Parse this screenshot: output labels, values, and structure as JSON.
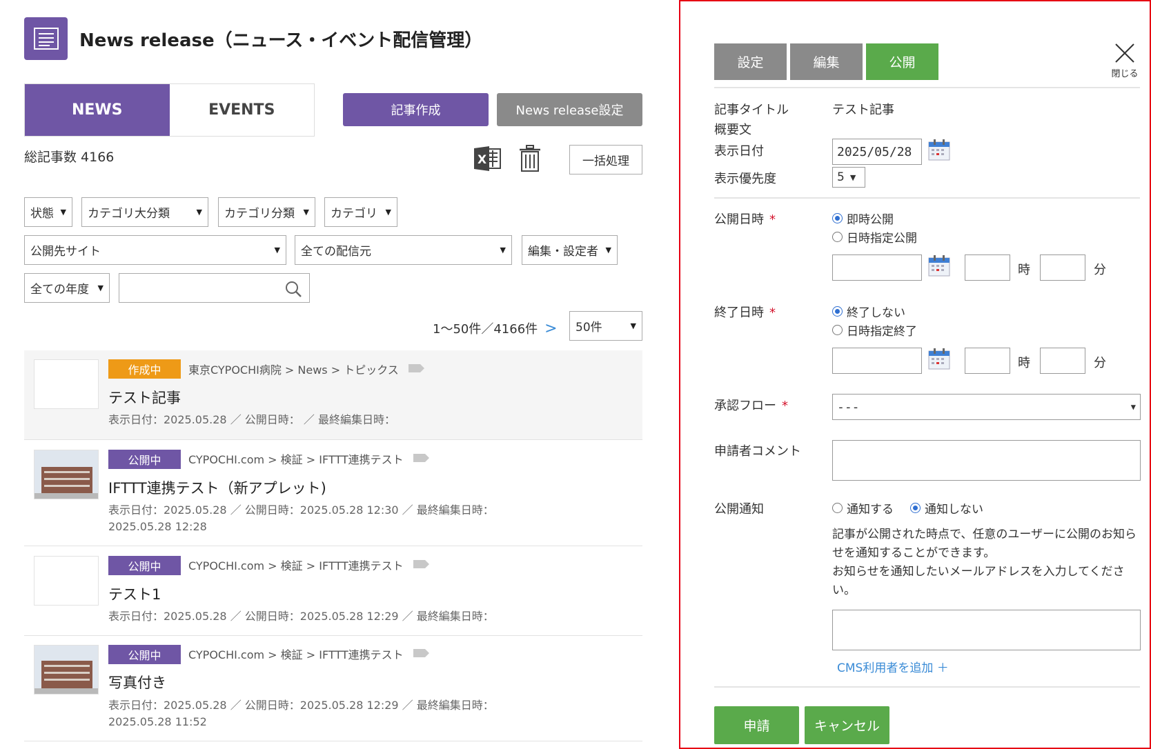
{
  "header": {
    "title": "News release（ニュース・イベント配信管理）"
  },
  "tabs": [
    {
      "label": "NEWS"
    },
    {
      "label": "EVENTS"
    }
  ],
  "actions": {
    "create": "記事作成",
    "settings": "News release設定",
    "bulk": "一括処理"
  },
  "summary": {
    "total": "総記事数 4166"
  },
  "filters": {
    "status": "状態",
    "category_major": "カテゴリ大分類",
    "category_sub": "カテゴリ分類",
    "category": "カテゴリ",
    "site": "公開先サイト",
    "source": "全ての配信元",
    "editor": "編集・設定者",
    "year": "全ての年度",
    "search_placeholder": ""
  },
  "pagination": {
    "range": "1〜50件／4166件",
    "next": ">",
    "per_page": "50件"
  },
  "articles": [
    {
      "status": "作成中",
      "crumb": "東京CYPOCHI病院 > News > トピックス",
      "title": "テスト記事",
      "meta": "表示日付：2025.05.28 ／ 公開日時： ／ 最終編集日時："
    },
    {
      "status": "公開中",
      "crumb": "CYPOCHI.com > 検証 > IFTTT連携テスト",
      "title": "IFTTT連携テスト（新アプレット)",
      "meta": "表示日付：2025.05.28 ／ 公開日時：2025.05.28 12:30 ／ 最終編集日時：2025.05.28 12:28"
    },
    {
      "status": "公開中",
      "crumb": "CYPOCHI.com > 検証 > IFTTT連携テスト",
      "title": "テスト1",
      "meta": "表示日付：2025.05.28 ／ 公開日時：2025.05.28 12:29 ／ 最終編集日時："
    },
    {
      "status": "公開中",
      "crumb": "CYPOCHI.com > 検証 > IFTTT連携テスト",
      "title": "写真付き",
      "meta": "表示日付：2025.05.28 ／ 公開日時：2025.05.28 12:29 ／ 最終編集日時：2025.05.28 11:52"
    }
  ],
  "panel": {
    "tabs": [
      {
        "label": "設定"
      },
      {
        "label": "編集"
      },
      {
        "label": "公開"
      }
    ],
    "close_label": "閉じる",
    "fields": {
      "title_label": "記事タイトル",
      "title_value": "テスト記事",
      "summary_label": "概要文",
      "date_label": "表示日付",
      "date_value": "2025/05/28",
      "priority_label": "表示優先度",
      "priority_value": "5",
      "publish_label": "公開日時",
      "publish_opt1": "即時公開",
      "publish_opt2": "日時指定公開",
      "end_label": "終了日時",
      "end_opt1": "終了しない",
      "end_opt2": "日時指定終了",
      "hour": "時",
      "minute": "分",
      "required_mark": "*",
      "flow_label": "承認フロー",
      "flow_value": "---",
      "comment_label": "申請者コメント",
      "notify_label": "公開通知",
      "notify_yes": "通知する",
      "notify_no": "通知しない",
      "notify_desc1": "記事が公開された時点で、任意のユーザーに公開のお知らせを通知することができます。",
      "notify_desc2": "お知らせを通知したいメールアドレスを入力してください。",
      "add_user": "CMS利用者を追加 ＋"
    },
    "buttons": {
      "apply": "申請",
      "cancel": "キャンセル"
    }
  },
  "colors": {
    "purple": "#6f56a5",
    "green": "#5aaa4b",
    "orange": "#ee9a17",
    "gray": "#8a8a8a",
    "panel_border": "#e60012",
    "link": "#3a8bd6"
  },
  "icons": {
    "app": "document-list-icon",
    "excel": "excel-icon",
    "trash": "trash-icon",
    "search": "search-icon",
    "calendar": "calendar-icon",
    "close": "close-icon",
    "tag": "tag-icon"
  }
}
